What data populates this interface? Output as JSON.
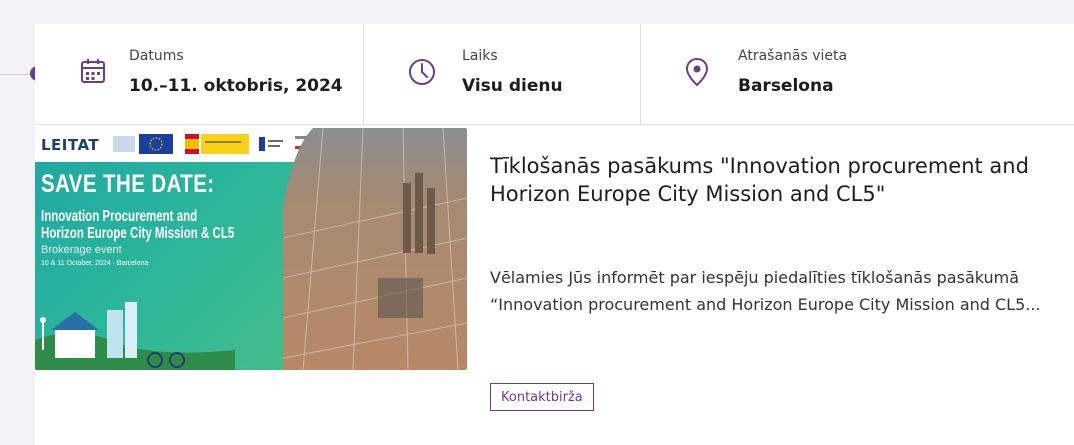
{
  "event": {
    "info": {
      "date": {
        "label": "Datums",
        "value": "10.–11. oktobris, 2024",
        "icon": "calendar-icon"
      },
      "time": {
        "label": "Laiks",
        "value": "Visu dienu",
        "icon": "clock-icon"
      },
      "location": {
        "label": "Atrašanās vieta",
        "value": "Barselona",
        "icon": "location-pin-icon"
      }
    },
    "title": "Tīklošanās pasākums \"Innovation procurement and Horizon Europe City Mission and CL5\"",
    "description": "Vēlamies Jūs informēt par iespēju piedalīties tīklošanās pasākumā “Innovation procurement and Horizon Europe City Mission and CL5...",
    "tag": "Kontaktbirža",
    "banner": {
      "org": "LEITAT",
      "headline": "SAVE THE DATE:",
      "line1": "Innovation Procurement and",
      "line2": "Horizon Europe City Mission & CL5",
      "subtitle": "Brokerage event",
      "dates": "10 & 11 October, 2024 · Barcelona"
    }
  },
  "colors": {
    "accent": "#6e3c8f",
    "banner_green": "#2cb69a"
  }
}
